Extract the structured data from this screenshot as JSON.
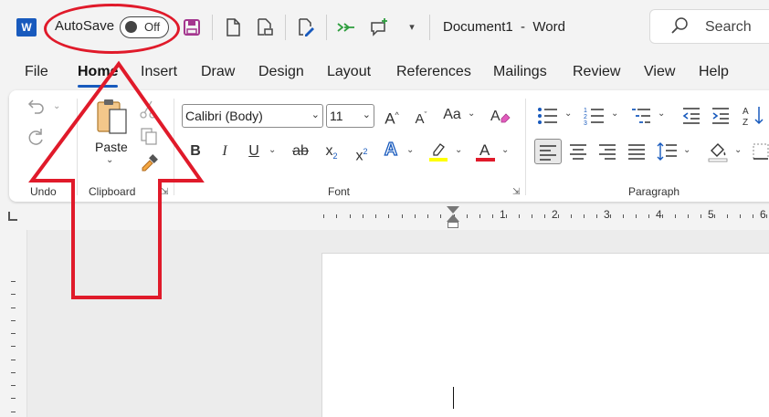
{
  "titlebar": {
    "logo_letter": "W",
    "autosave_label": "AutoSave",
    "autosave_state": "Off",
    "document_title": "Document1  -  Word",
    "search_placeholder": "Search"
  },
  "tabs": [
    {
      "label": "File"
    },
    {
      "label": "Home"
    },
    {
      "label": "Insert"
    },
    {
      "label": "Draw"
    },
    {
      "label": "Design"
    },
    {
      "label": "Layout"
    },
    {
      "label": "References"
    },
    {
      "label": "Mailings"
    },
    {
      "label": "Review"
    },
    {
      "label": "View"
    },
    {
      "label": "Help"
    }
  ],
  "ribbon": {
    "undo_group_label": "Undo",
    "clipboard_group_label": "Clipboard",
    "paste_label": "Paste",
    "font_group_label": "Font",
    "paragraph_group_label": "Paragraph",
    "font_name": "Calibri (Body)",
    "font_size": "11",
    "change_case_label": "Aa"
  },
  "ruler": {
    "numbers": [
      "1",
      "2",
      "3",
      "4",
      "5",
      "6"
    ]
  },
  "colors": {
    "word_blue": "#185abd",
    "highlight": "#ffff00",
    "font_color": "#e01a2a",
    "annotation": "#e01a2a"
  }
}
